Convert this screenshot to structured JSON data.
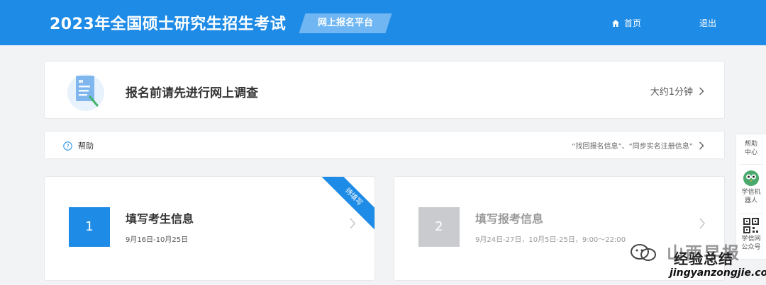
{
  "header": {
    "title": "2023年全国硕士研究生招生考试",
    "platform_badge": "网上报名平台",
    "nav_home": "首页",
    "nav_logout": "退出",
    "bg_color": "#1e8be6"
  },
  "survey": {
    "title": "报名前请先进行网上调查",
    "time": "大约1分钟",
    "icon": "survey-document-icon"
  },
  "help": {
    "label": "帮助",
    "links": "“找回报名信息”、“同步实名注册信息”",
    "icon": "question-circle-icon"
  },
  "steps": [
    {
      "number": "1",
      "title": "填写考生信息",
      "date": "9月16日-10月25日",
      "ribbon": "待填写",
      "color": "#1e8be6"
    },
    {
      "number": "2",
      "title": "填写报考信息",
      "date": "9月24日-27日，10月5日-25日，9:00～22:00",
      "color": "#c9cbce"
    }
  ],
  "side_panel": {
    "help_center": "帮助中心",
    "robot": "学信机器人",
    "public_account": "学信网公众号"
  },
  "watermark": {
    "brand": "山西早报",
    "site_name": "经验总结",
    "url": "jingyanzongjie.com"
  }
}
